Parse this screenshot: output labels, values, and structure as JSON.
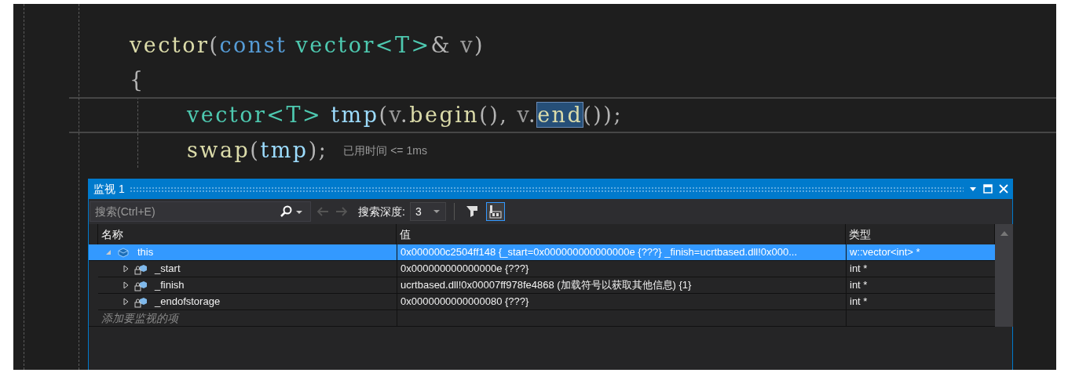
{
  "code": [
    {
      "tokens": [
        {
          "text": "vector",
          "kind": "func"
        },
        {
          "text": "(",
          "kind": "punct"
        },
        {
          "text": "const ",
          "kind": "keyword"
        },
        {
          "text": "vector<T>",
          "kind": "type"
        },
        {
          "text": "& ",
          "kind": "punct"
        },
        {
          "text": "v",
          "kind": "param"
        },
        {
          "text": ")",
          "kind": "punct"
        }
      ]
    },
    {
      "tokens": [
        {
          "text": "{",
          "kind": "punct"
        }
      ],
      "children": [
        {
          "tokens": [
            {
              "text": "vector<T> ",
              "kind": "type"
            },
            {
              "text": "tmp",
              "kind": "local"
            },
            {
              "text": "(",
              "kind": "punct"
            },
            {
              "text": "v",
              "kind": "param"
            },
            {
              "text": ".",
              "kind": "punct"
            },
            {
              "text": "begin",
              "kind": "func"
            },
            {
              "text": "(), ",
              "kind": "punct"
            },
            {
              "text": "v",
              "kind": "param"
            },
            {
              "text": ".",
              "kind": "punct"
            },
            {
              "text": "end",
              "kind": "func",
              "selected": true
            },
            {
              "text": "());",
              "kind": "punct"
            }
          ],
          "current": true
        },
        {
          "tokens": [
            {
              "text": "swap",
              "kind": "func"
            },
            {
              "text": "(",
              "kind": "punct"
            },
            {
              "text": "tmp",
              "kind": "local"
            },
            {
              "text": ");",
              "kind": "punct"
            }
          ],
          "hint": "已用时间 <= 1ms"
        }
      ]
    }
  ],
  "watch": {
    "title": "监视 1",
    "toolbar": {
      "search": {
        "placeholder": "搜索(Ctrl+E)"
      },
      "nav": [
        {
          "kind": "back",
          "disabled": true
        },
        {
          "kind": "forward",
          "disabled": true
        }
      ],
      "depth_label": "搜索深度:",
      "depth_value": "3",
      "toggles": [
        {
          "kind": "filter",
          "selected": false
        },
        {
          "kind": "hex",
          "selected": true
        }
      ]
    },
    "columns": [
      "名称",
      "值",
      "类型"
    ],
    "rows": [
      {
        "name": "this",
        "value": "0x000000c2504ff148 {_start=0x000000000000000e {???} _finish=ucrtbased.dll!0x000...",
        "type": "w::vector<int> *",
        "kind": "object",
        "expanded": true,
        "selected": true,
        "children": [
          {
            "name": "_start",
            "value": "0x000000000000000e {???}",
            "type": "int *",
            "kind": "private-field",
            "expanded": false,
            "selected": false
          },
          {
            "name": "_finish",
            "value": "ucrtbased.dll!0x00007ff978fe4868 (加载符号以获取其他信息) {1}",
            "type": "int *",
            "kind": "private-field",
            "expanded": false,
            "selected": false
          },
          {
            "name": "_endofstorage",
            "value": "0x0000000000000080 {???}",
            "type": "int *",
            "kind": "private-field",
            "expanded": false,
            "selected": false
          }
        ]
      }
    ],
    "add_row": {
      "placeholder": "添加要监视的项"
    }
  }
}
